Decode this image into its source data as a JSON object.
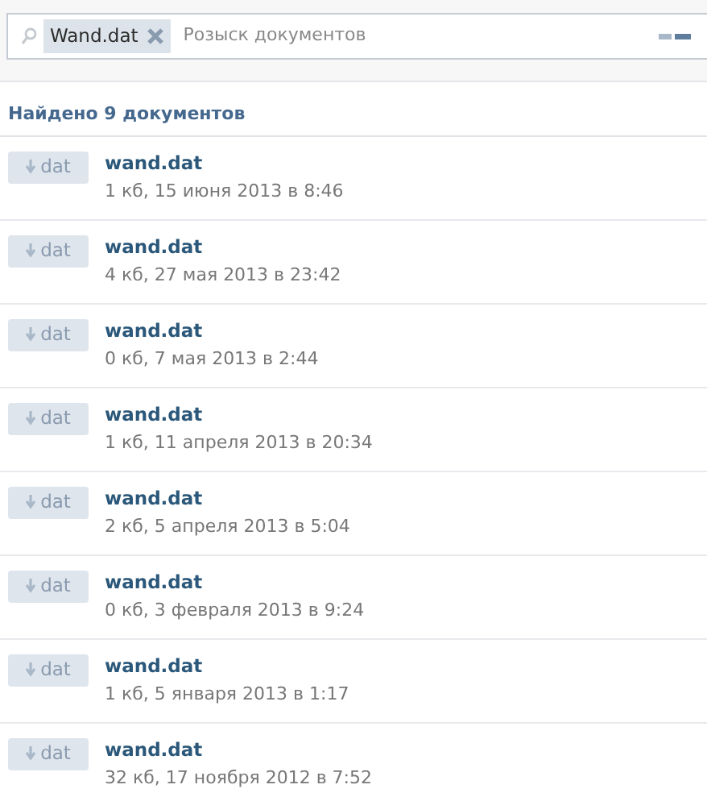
{
  "search": {
    "token": "Wand.dat",
    "placeholder": "Розыск документов"
  },
  "summary": "Найдено 9 документов",
  "documents": [
    {
      "ext": "dat",
      "name": "wand.dat",
      "meta": "1 кб, 15 июня 2013 в 8:46"
    },
    {
      "ext": "dat",
      "name": "wand.dat",
      "meta": "4 кб, 27 мая 2013 в 23:42"
    },
    {
      "ext": "dat",
      "name": "wand.dat",
      "meta": "0 кб, 7 мая 2013 в 2:44"
    },
    {
      "ext": "dat",
      "name": "wand.dat",
      "meta": "1 кб, 11 апреля 2013 в 20:34"
    },
    {
      "ext": "dat",
      "name": "wand.dat",
      "meta": "2 кб, 5 апреля 2013 в 5:04"
    },
    {
      "ext": "dat",
      "name": "wand.dat",
      "meta": "0 кб, 3 февраля 2013 в 9:24"
    },
    {
      "ext": "dat",
      "name": "wand.dat",
      "meta": "1 кб, 5 января 2013 в 1:17"
    },
    {
      "ext": "dat",
      "name": "wand.dat",
      "meta": "32 кб, 17 ноября 2012 в 7:52"
    }
  ]
}
